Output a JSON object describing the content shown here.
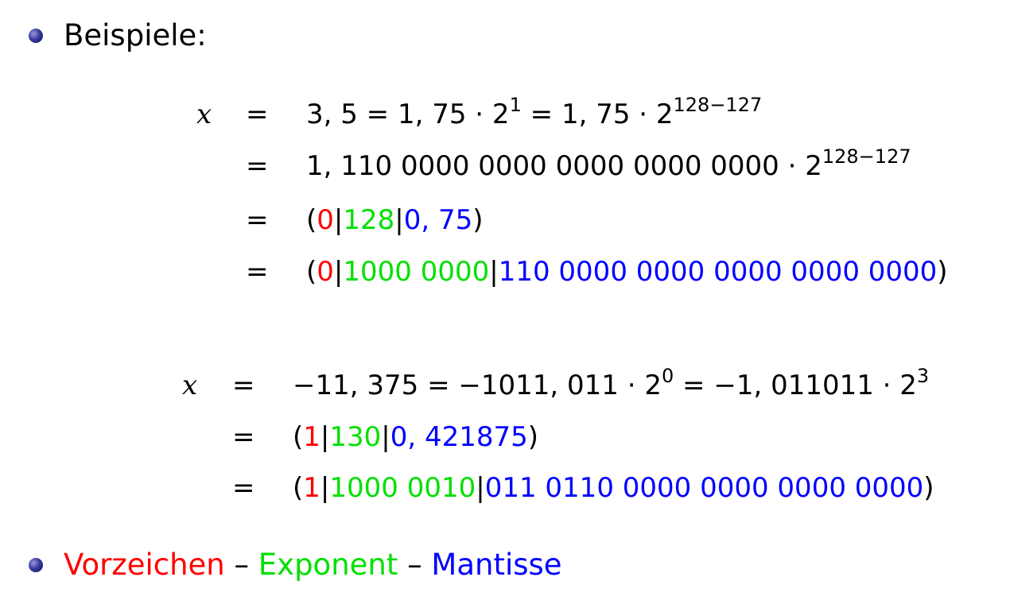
{
  "bullets": {
    "examples_label": "Beispiele:",
    "legend": {
      "sign": "Vorzeichen",
      "dash1": " – ",
      "exponent": "Exponent",
      "dash2": " – ",
      "mantissa": "Mantisse"
    }
  },
  "example1": {
    "lhs": "x",
    "eq": "=",
    "line1": {
      "a": "3, 5 = 1, 75 · 2",
      "sup1": "1",
      "b": " = 1, 75 · 2",
      "sup2": "128−127"
    },
    "line2": {
      "a": "1, 110 0000 0000 0000 0000 0000 · 2",
      "sup": "128−127"
    },
    "line3": {
      "open": "(",
      "sign": "0",
      "bar1": "|",
      "exponent": "128",
      "bar2": "|",
      "mantissa": "0, 75",
      "close": ")"
    },
    "line4": {
      "open": "(",
      "sign": "0",
      "bar1": "|",
      "exponent": "1000 0000",
      "bar2": "|",
      "mantissa": "110 0000 0000 0000 0000 0000",
      "close": ")"
    }
  },
  "example2": {
    "lhs": "x",
    "eq": "=",
    "line1": {
      "a": "−11, 375 = −1011, 011 · 2",
      "sup1": "0",
      "b": " = −1, 011011 · 2",
      "sup2": "3"
    },
    "line2": {
      "open": "(",
      "sign": "1",
      "bar1": "|",
      "exponent": "130",
      "bar2": "|",
      "mantissa": "0, 421875",
      "close": ")"
    },
    "line3": {
      "open": "(",
      "sign": "1",
      "bar1": "|",
      "exponent": "1000 0010",
      "bar2": "|",
      "mantissa": "011 0110 0000 0000 0000 0000",
      "close": ")"
    }
  },
  "colors": {
    "sign": "#ff0000",
    "exponent": "#00e000",
    "mantissa": "#0000ff",
    "bullet": "#2a2a8a"
  },
  "icons": {
    "bullet": "bullet-dot-icon"
  }
}
